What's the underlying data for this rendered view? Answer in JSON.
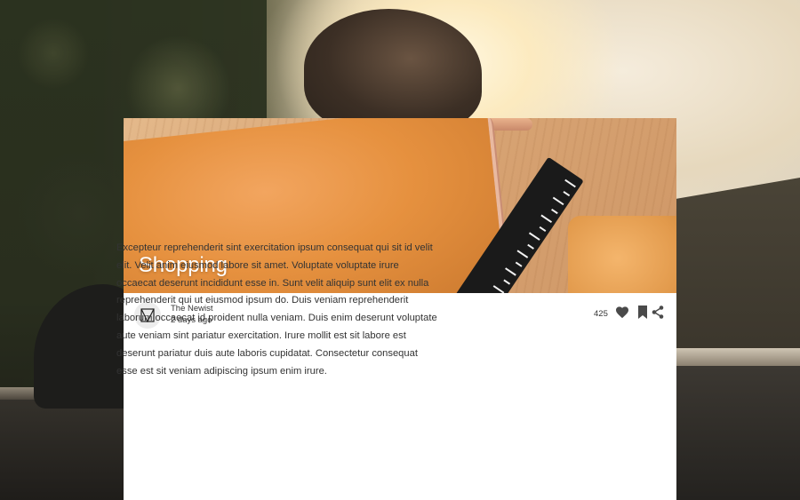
{
  "post": {
    "title": "Shopping",
    "author": "The Newist",
    "date": "2 days ago",
    "like_count": "425",
    "body": "Excepteur reprehenderit sint exercitation ipsum consequat qui sit id velit elit. Velit anim eiusmod labore sit amet. Voluptate voluptate irure occaecat deserunt incididunt esse in. Sunt velit aliquip sunt elit ex nulla reprehenderit qui ut eiusmod ipsum do. Duis veniam reprehenderit laborum occaecat id proident nulla veniam. Duis enim deserunt voluptate aute veniam sint pariatur exercitation. Irure mollit est sit labore est deserunt pariatur duis aute laboris cupidatat. Consectetur consequat esse est sit veniam adipiscing ipsum enim irure."
  },
  "icons": {
    "avatar": "newist-logo-icon",
    "like": "heart-icon",
    "bookmark": "bookmark-icon",
    "share": "share-icon"
  },
  "colors": {
    "text": "#333333",
    "card": "#ffffff",
    "icon": "#4a4a4a"
  }
}
